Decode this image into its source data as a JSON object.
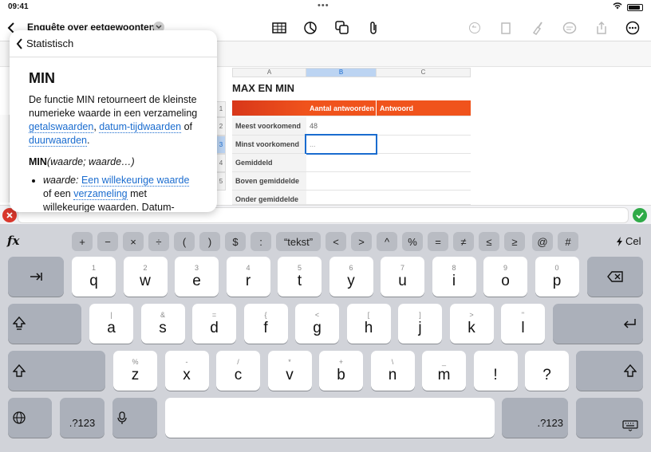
{
  "status": {
    "time": "09:41",
    "dots": "•••"
  },
  "toolbar": {
    "doc_title": "Enquête over eetgewoonten"
  },
  "sheet": {
    "col_headers": [
      "A",
      "B",
      "C"
    ],
    "row_headers": [
      "1",
      "2",
      "3",
      "4",
      "5"
    ],
    "title": "MAX EN MIN",
    "header_b": "Aantal antwoorden",
    "header_c": "Antwoord",
    "rows": [
      {
        "label": "Meest voorkomend",
        "value": "48"
      },
      {
        "label": "Minst voorkomend",
        "value": "..."
      },
      {
        "label": "Gemiddeld",
        "value": ""
      },
      {
        "label": "Boven gemiddelde",
        "value": ""
      },
      {
        "label": "Onder gemiddelde",
        "value": ""
      }
    ],
    "accent": "#f0531c",
    "selection": "#1a6ccf"
  },
  "popover": {
    "back_label": "Statistisch",
    "heading": "MIN",
    "desc_1": "De functie MIN retourneert de kleinste numerieke waarde in een verzameling ",
    "link_1": "getalswaarden",
    "sep_1": ", ",
    "link_2": "datum-tijdwaarden",
    "sep_2": " of ",
    "link_3": "duurwaarden",
    "end": ".",
    "syntax_name": "MIN",
    "syntax_args": "(waarde; waarde…)",
    "bullet_term": "waarde:",
    "bullet_link_1": "Een willekeurige waarde",
    "bullet_text_1": " of een ",
    "bullet_link_2": "verzameling",
    "bullet_text_2": " met willekeurige waarden. Datum-tijdwaarden of"
  },
  "symbols": [
    "fx",
    "+",
    "−",
    "×",
    "÷",
    "(",
    ")",
    "$",
    ":",
    "“tekst”",
    "<",
    ">",
    "^",
    "%",
    "=",
    "≠",
    "≤",
    "≥",
    "@",
    "#",
    "Cel"
  ],
  "keys_row1": [
    [
      "1",
      "q"
    ],
    [
      "2",
      "w"
    ],
    [
      "3",
      "e"
    ],
    [
      "4",
      "r"
    ],
    [
      "5",
      "t"
    ],
    [
      "6",
      "y"
    ],
    [
      "7",
      "u"
    ],
    [
      "8",
      "i"
    ],
    [
      "9",
      "o"
    ],
    [
      "0",
      "p"
    ]
  ],
  "keys_row2": [
    [
      "|",
      "a"
    ],
    [
      "&",
      "s"
    ],
    [
      "=",
      "d"
    ],
    [
      "{",
      "f"
    ],
    [
      "<",
      "g"
    ],
    [
      "[",
      "h"
    ],
    [
      "]",
      "j"
    ],
    [
      ">",
      "k"
    ],
    [
      "\"",
      "l"
    ]
  ],
  "keys_row3": [
    [
      "%",
      "z"
    ],
    [
      "-",
      "x"
    ],
    [
      "/",
      "c"
    ],
    [
      "*",
      "v"
    ],
    [
      "+",
      "b"
    ],
    [
      "\\",
      "n"
    ],
    [
      "_",
      "m"
    ],
    [
      "",
      "!"
    ],
    [
      "",
      "?"
    ]
  ],
  "numeric_label": ".?123"
}
